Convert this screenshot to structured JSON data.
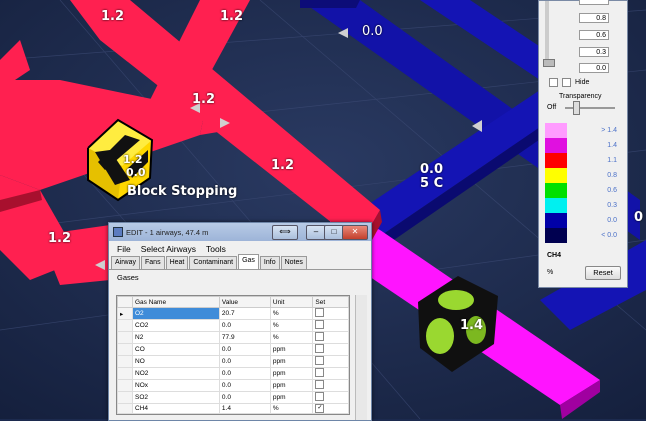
{
  "scene": {
    "airway_labels": {
      "top_left_a": "1.2",
      "top_left_b": "1.2",
      "junction": "1.2",
      "mid_right": "1.2",
      "left_lower": "1.2",
      "blue_top": "0.0",
      "blue_mid": "0.0",
      "blue_temp": "5 C",
      "far_right": "0",
      "magenta": "1.4"
    },
    "stopping_label": "Block Stopping",
    "stopping_value_a": "1.2",
    "stopping_value_b": "0.0",
    "colors": {
      "red_airway": "#ff2050",
      "blue_airway": "#1414b4",
      "magenta_airway": "#ff14ff",
      "background": "#1c2a4e"
    }
  },
  "edit_window": {
    "title": "EDIT - 1 airways, 47.4 m",
    "menu": [
      "File",
      "Select Airways",
      "Tools"
    ],
    "tabs": [
      "Airway",
      "Fans",
      "Heat",
      "Contaminant",
      "Gas",
      "Info",
      "Notes"
    ],
    "active_tab": "Gas",
    "group_label": "Gases",
    "columns": [
      "Gas Name",
      "Value",
      "Unit",
      "Set"
    ],
    "rows": [
      {
        "name": "O2",
        "value": "20.7",
        "unit": "%",
        "set": false
      },
      {
        "name": "CO2",
        "value": "0.0",
        "unit": "%",
        "set": false
      },
      {
        "name": "N2",
        "value": "77.9",
        "unit": "%",
        "set": false
      },
      {
        "name": "CO",
        "value": "0.0",
        "unit": "ppm",
        "set": false
      },
      {
        "name": "NO",
        "value": "0.0",
        "unit": "ppm",
        "set": false
      },
      {
        "name": "NO2",
        "value": "0.0",
        "unit": "ppm",
        "set": false
      },
      {
        "name": "NOx",
        "value": "0.0",
        "unit": "ppm",
        "set": false
      },
      {
        "name": "SO2",
        "value": "0.0",
        "unit": "ppm",
        "set": false
      },
      {
        "name": "CH4",
        "value": "1.4",
        "unit": "%",
        "set": true
      }
    ]
  },
  "legend_panel": {
    "spin_values": [
      "0.8",
      "0.6",
      "0.3",
      "0.0"
    ],
    "hide_label": "Hide",
    "transparency_label": "Transparency",
    "off_label": "Off",
    "scale": [
      {
        "label": "> 1.4",
        "color": "#ff9cff"
      },
      {
        "label": "1.4",
        "color": "#e010e0"
      },
      {
        "label": "1.1",
        "color": "#ff0000"
      },
      {
        "label": "0.8",
        "color": "#ffff00"
      },
      {
        "label": "0.6",
        "color": "#00e000"
      },
      {
        "label": "0.3",
        "color": "#00f0f0"
      },
      {
        "label": "0.0",
        "color": "#0000a8"
      },
      {
        "label": "< 0.0",
        "color": "#000050"
      }
    ],
    "gas_name": "CH4",
    "unit_label": "%",
    "reset_label": "Reset"
  }
}
